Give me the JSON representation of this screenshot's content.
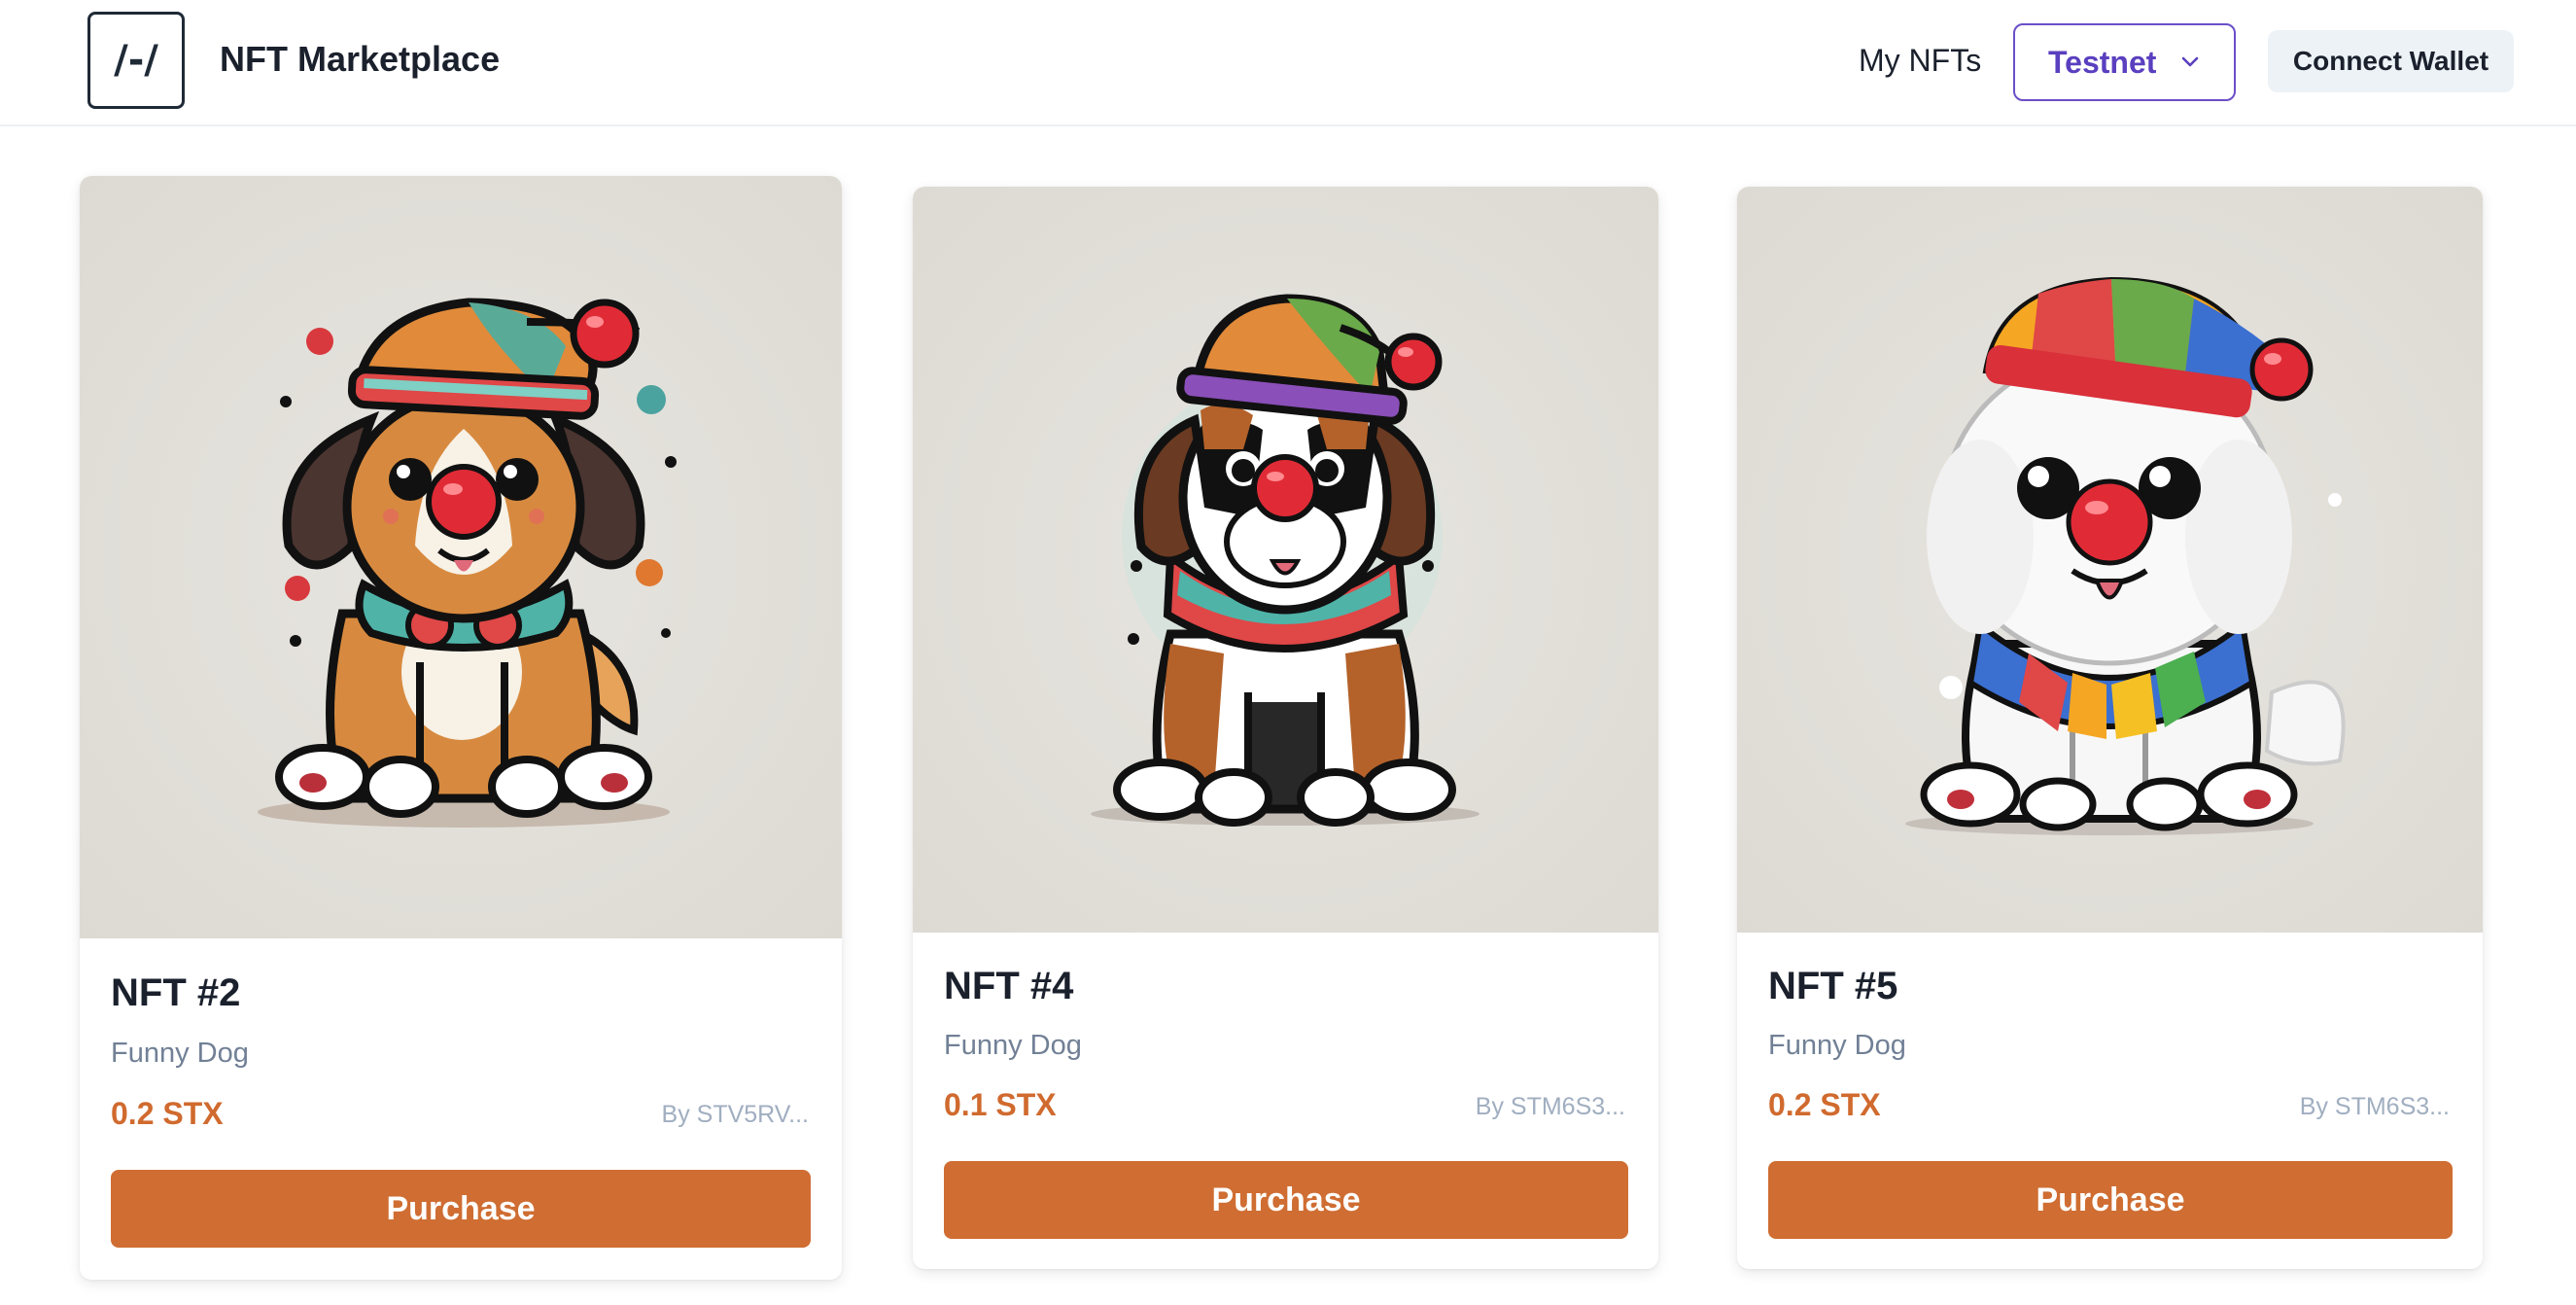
{
  "header": {
    "logo_text": "/-/",
    "title": "NFT Marketplace",
    "my_nfts_label": "My NFTs",
    "network": "Testnet",
    "connect_label": "Connect Wallet"
  },
  "colors": {
    "accent": "#cf6d32",
    "network_purple": "#5a3fbf",
    "price_orange": "#d06a2e"
  },
  "cards": [
    {
      "name": "NFT #2",
      "collection": "Funny Dog",
      "price": "0.2 STX",
      "owner": "By STV5RV...",
      "button": "Purchase",
      "image": "clown-dog-brown-illustration"
    },
    {
      "name": "NFT #4",
      "collection": "Funny Dog",
      "price": "0.1 STX",
      "owner": "By STM6S3...",
      "button": "Purchase",
      "image": "clown-dog-saint-bernard-illustration"
    },
    {
      "name": "NFT #5",
      "collection": "Funny Dog",
      "price": "0.2 STX",
      "owner": "By STM6S3...",
      "button": "Purchase",
      "image": "clown-dog-white-fluffy-illustration"
    }
  ]
}
